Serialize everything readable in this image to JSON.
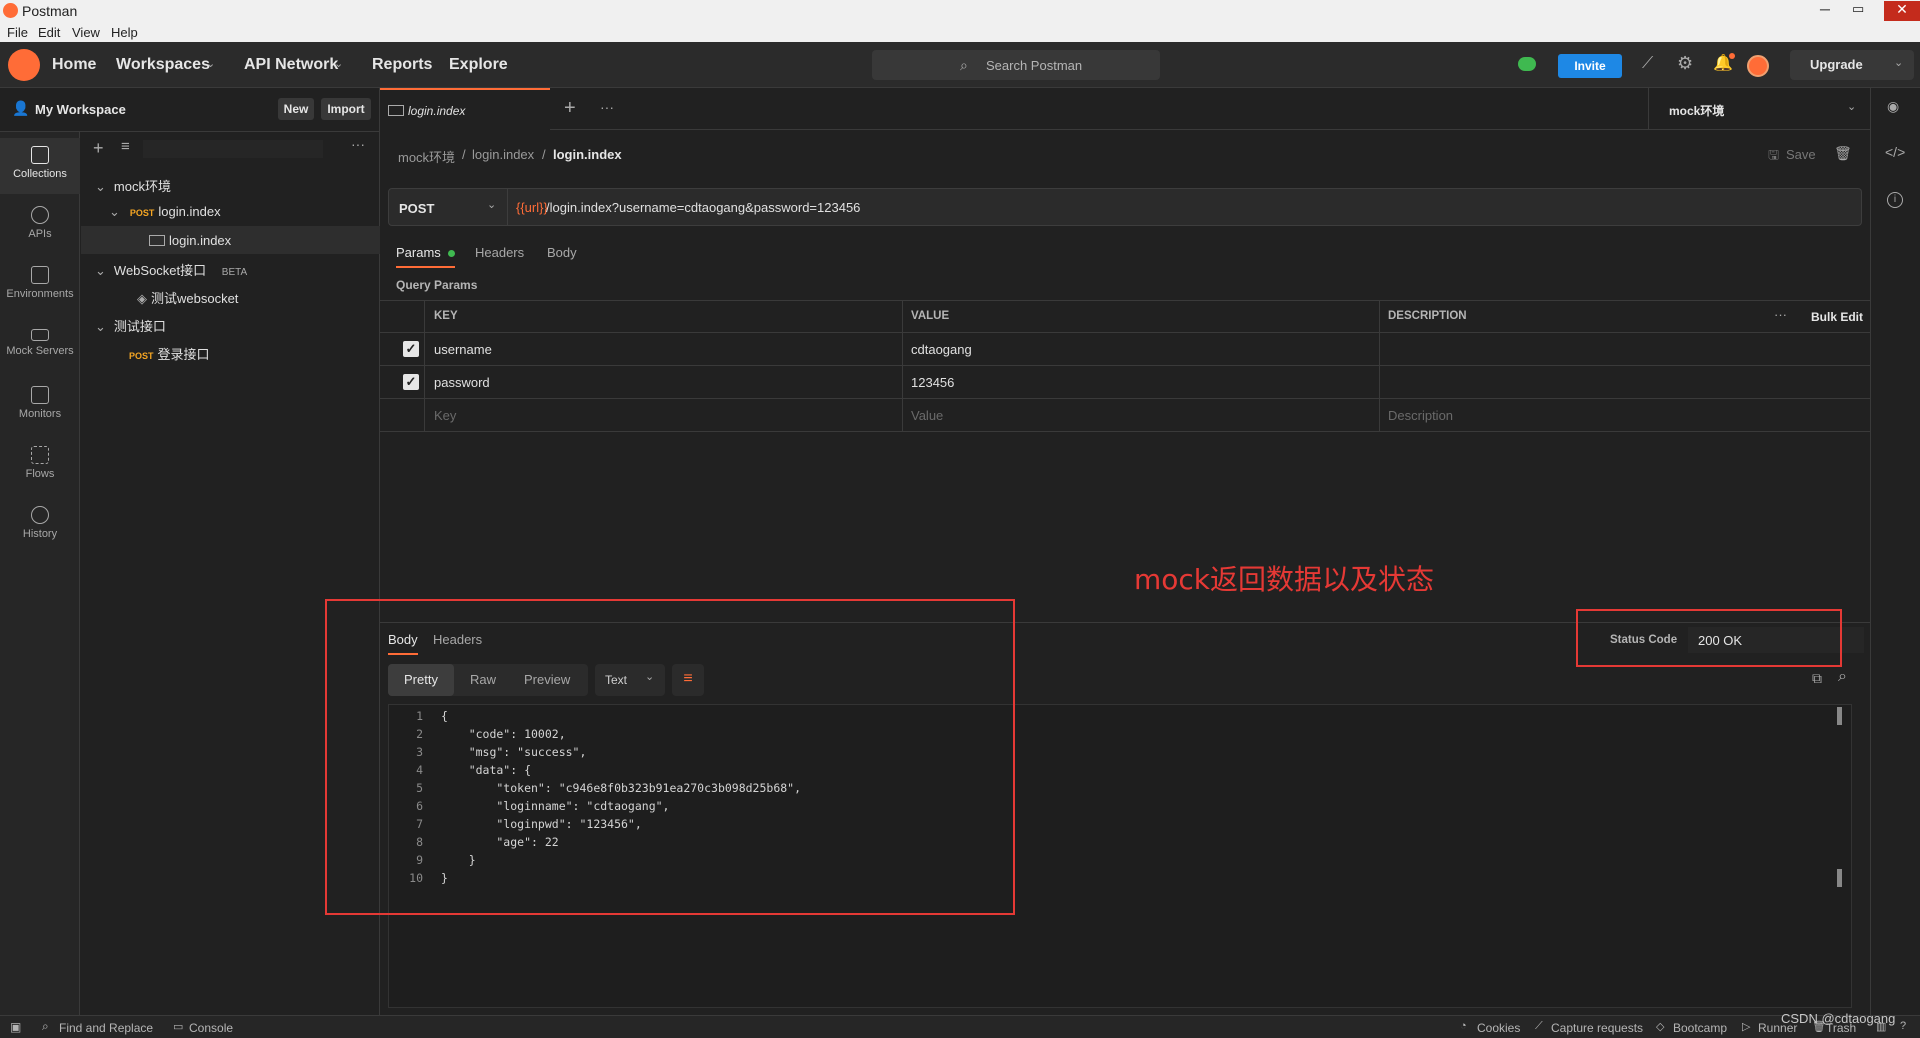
{
  "window": {
    "title": "Postman"
  },
  "menu": [
    "File",
    "Edit",
    "View",
    "Help"
  ],
  "nav": {
    "home": "Home",
    "workspaces": "Workspaces",
    "api_network": "API Network",
    "reports": "Reports",
    "explore": "Explore"
  },
  "search": {
    "placeholder": "Search Postman"
  },
  "header_right": {
    "invite": "Invite",
    "upgrade": "Upgrade"
  },
  "workspace": {
    "name": "My Workspace",
    "new": "New",
    "import": "Import"
  },
  "rail": [
    "Collections",
    "APIs",
    "Environments",
    "Mock Servers",
    "Monitors",
    "Flows",
    "History"
  ],
  "tree": {
    "c1": "mock环境",
    "c1_req": "login.index",
    "c1_example": "login.index",
    "c2": "WebSocket接口",
    "c2_badge": "BETA",
    "c2_req": "测试websocket",
    "c3": "测试接口",
    "c3_req": "登录接口",
    "method": "POST"
  },
  "tab": {
    "name": "login.index",
    "env": "mock环境"
  },
  "breadcrumb": {
    "a": "mock环境",
    "sep": "/",
    "b": "login.index",
    "c": "login.index"
  },
  "save": "Save",
  "request": {
    "method": "POST",
    "url_var": "{{url}}",
    "url_rest": "/login.index?username=cdtaogang&password=123456"
  },
  "req_tabs": {
    "params": "Params",
    "headers": "Headers",
    "body": "Body"
  },
  "query_params_title": "Query Params",
  "table": {
    "headers": {
      "key": "KEY",
      "value": "VALUE",
      "description": "DESCRIPTION",
      "bulk_edit": "Bulk Edit"
    },
    "rows": [
      {
        "key": "username",
        "value": "cdtaogang"
      },
      {
        "key": "password",
        "value": "123456"
      }
    ],
    "placeholders": {
      "key": "Key",
      "value": "Value",
      "description": "Description"
    }
  },
  "annotation": "mock返回数据以及状态",
  "response": {
    "tabs": {
      "body": "Body",
      "headers": "Headers"
    },
    "views": {
      "pretty": "Pretty",
      "raw": "Raw",
      "preview": "Preview",
      "format": "Text"
    },
    "status_label": "Status Code",
    "status_value": "200 OK",
    "lines": [
      "{",
      "    \"code\": 10002,",
      "    \"msg\": \"success\",",
      "    \"data\": {",
      "        \"token\": \"c946e8f0b323b91ea270c3b098d25b68\",",
      "        \"loginname\": \"cdtaogang\",",
      "        \"loginpwd\": \"123456\",",
      "        \"age\": 22",
      "    }",
      "}"
    ],
    "line_numbers": [
      "1",
      "2",
      "3",
      "4",
      "5",
      "6",
      "7",
      "8",
      "9",
      "10"
    ]
  },
  "statusbar": {
    "find": "Find and Replace",
    "console": "Console",
    "cookies": "Cookies",
    "capture": "Capture requests",
    "bootcamp": "Bootcamp",
    "runner": "Runner",
    "trash": "Trash",
    "watermark": "CSDN @cdtaogang"
  },
  "colors": {
    "accent": "#ff6c37",
    "annotation": "#e53935",
    "invite": "#1e88e5",
    "method_post": "#f6a623"
  }
}
